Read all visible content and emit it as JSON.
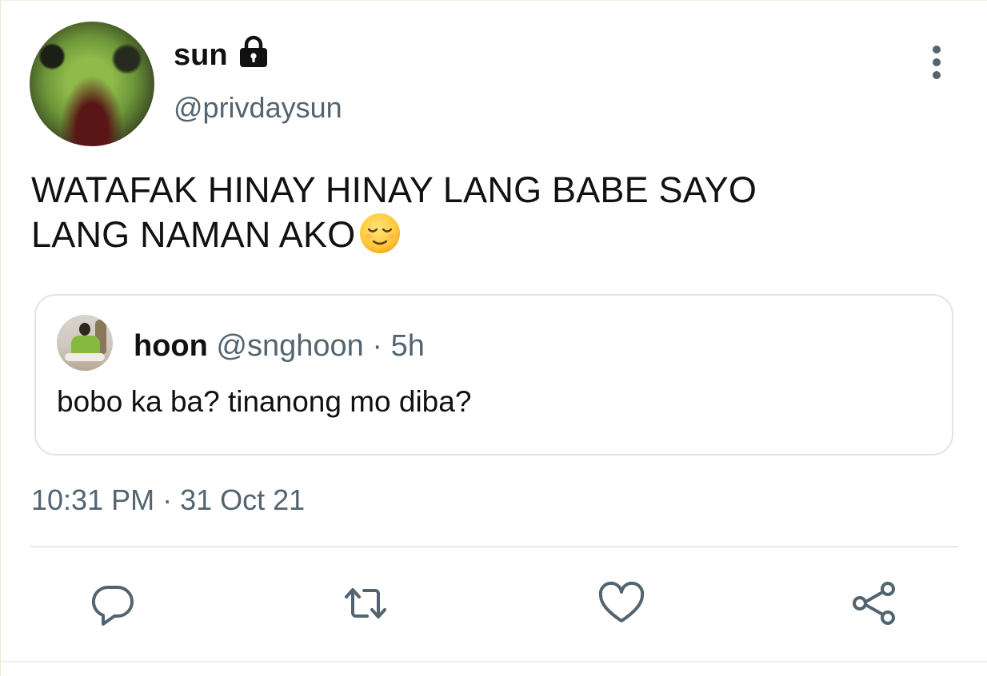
{
  "tweet": {
    "author": {
      "display_name": "sun",
      "handle": "@privdaysun",
      "protected_icon": "lock-icon"
    },
    "text_lines": [
      "WATAFAK HINAY HINAY LANG BABE SAYO",
      "LANG NAMAN AKO"
    ],
    "emoji": "relieved-face-emoji",
    "timestamp": "10:31 PM · 31 Oct 21"
  },
  "quoted_tweet": {
    "display_name": "hoon",
    "handle": "@snghoon",
    "meta": " · 5h",
    "text": "bobo ka ba? tinanong mo diba?"
  },
  "actions": [
    {
      "name": "reply",
      "icon": "reply-icon"
    },
    {
      "name": "retweet",
      "icon": "retweet-icon"
    },
    {
      "name": "like",
      "icon": "heart-icon"
    },
    {
      "name": "share",
      "icon": "share-icon"
    }
  ],
  "colors": {
    "text_primary": "#111111",
    "text_secondary": "#536471",
    "border": "#dfe4e8",
    "icon": "#536471"
  }
}
